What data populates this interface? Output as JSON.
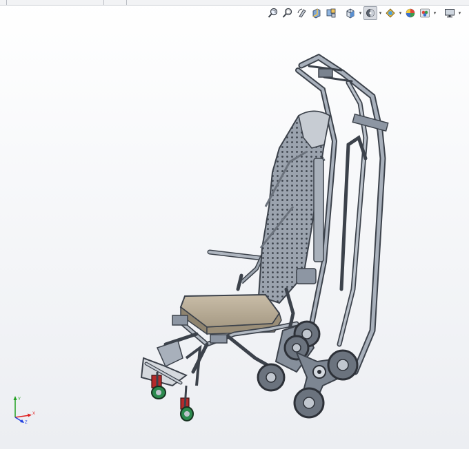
{
  "view_toolbar": {
    "items": [
      {
        "id": "zoom-to-fit",
        "icon": "zoom-to-fit-icon"
      },
      {
        "id": "zoom-to-area",
        "icon": "zoom-to-area-icon"
      },
      {
        "id": "previous-view",
        "icon": "previous-view-icon"
      },
      {
        "id": "section-view",
        "icon": "section-view-icon"
      },
      {
        "id": "dynamic-annotation",
        "icon": "dynamic-annotation-icon"
      },
      {
        "id": "view-orientation",
        "icon": "view-orientation-icon",
        "dropdown": true
      },
      {
        "id": "display-style",
        "icon": "display-style-icon",
        "dropdown": true,
        "active": true
      },
      {
        "id": "hide-show-items",
        "icon": "hide-show-items-icon",
        "dropdown": true
      },
      {
        "id": "edit-appearance",
        "icon": "edit-appearance-icon"
      },
      {
        "id": "apply-scene",
        "icon": "apply-scene-icon",
        "dropdown": true
      },
      {
        "id": "view-settings",
        "icon": "view-settings-icon",
        "dropdown": true
      }
    ]
  },
  "triad": {
    "x_label": "X",
    "y_label": "Y",
    "z_label": "Z",
    "colors": {
      "x": "#e02020",
      "y": "#20a020",
      "z": "#2040e0"
    }
  },
  "colors": {
    "frame": "#8d96a3",
    "frame_dark": "#3c424b",
    "seat": "#b8ab95",
    "accent": "#b52a2a",
    "wheel_green": "#2c8a4e"
  }
}
